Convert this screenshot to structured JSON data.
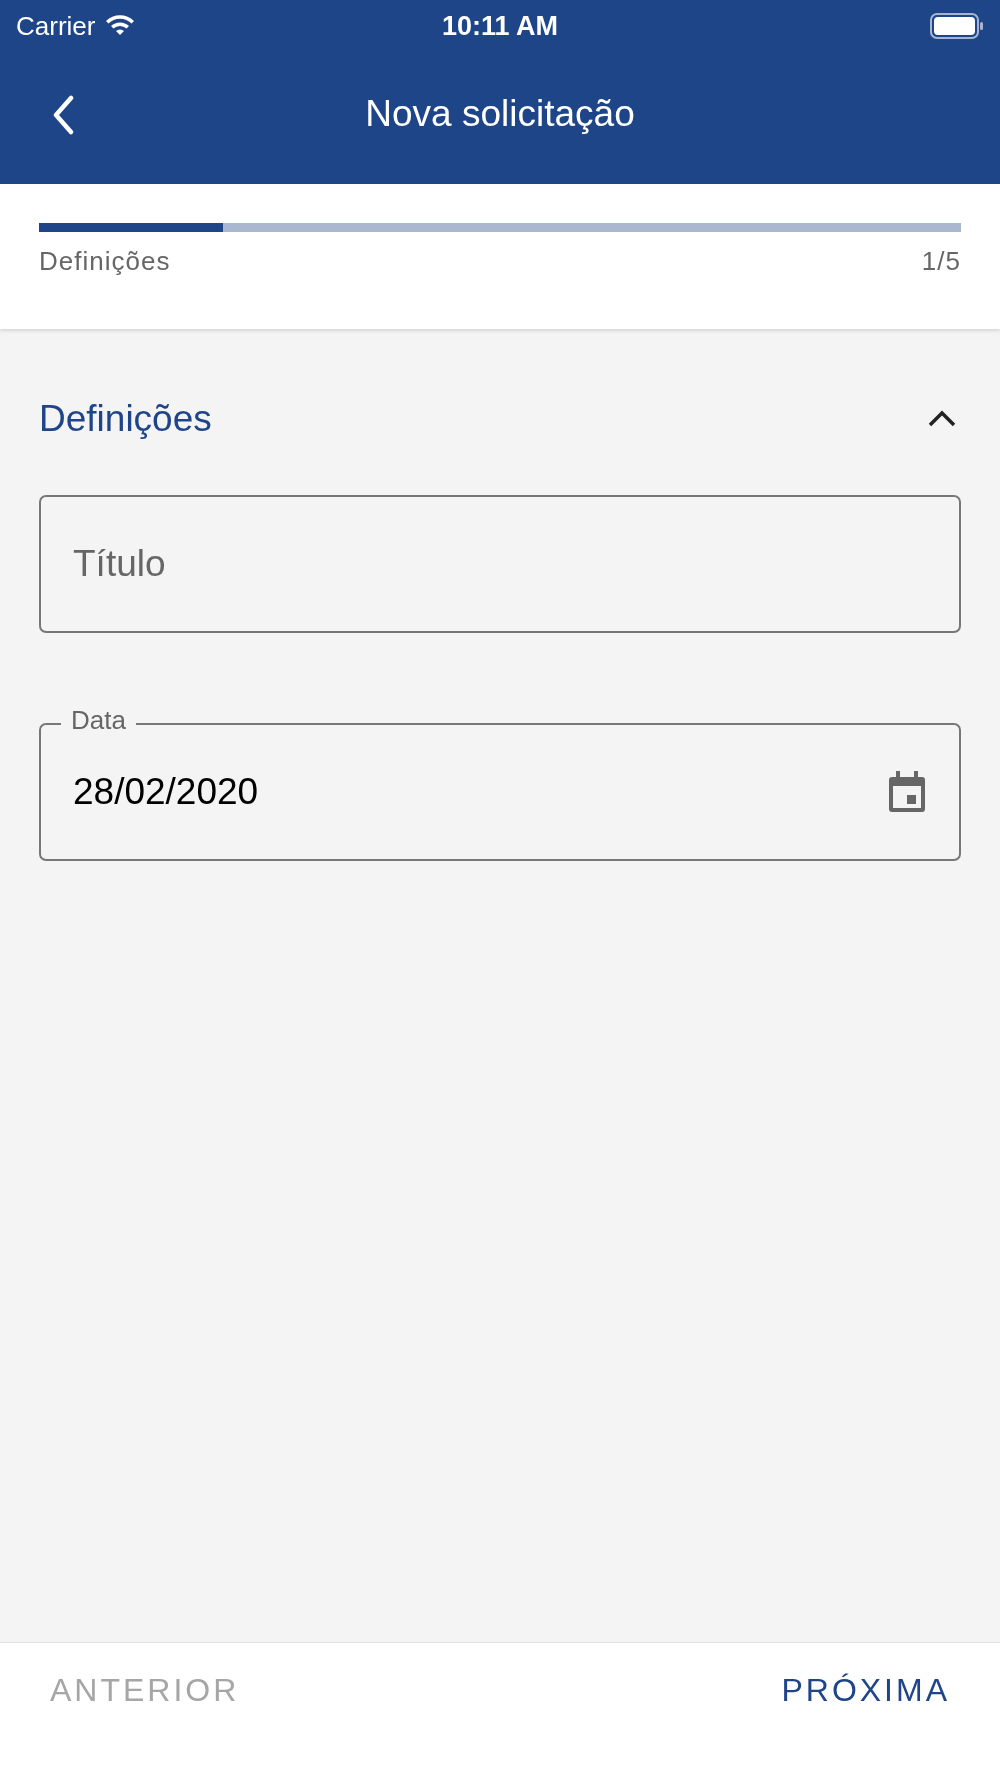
{
  "status_bar": {
    "carrier": "Carrier",
    "time": "10:11 AM"
  },
  "header": {
    "title": "Nova solicitação"
  },
  "progress": {
    "label": "Definições",
    "step": "1/5",
    "level": 0.2
  },
  "section": {
    "title": "Definições",
    "expanded": true
  },
  "fields": [
    {
      "kind": "text",
      "placeholder": "Título"
    },
    {
      "kind": "date",
      "label": "Data",
      "value": "28/02/2020"
    }
  ],
  "footer": [
    {
      "label": "ANTERIOR",
      "disabled": true
    },
    {
      "label": "PRÓXIMA",
      "disabled": false
    }
  ]
}
